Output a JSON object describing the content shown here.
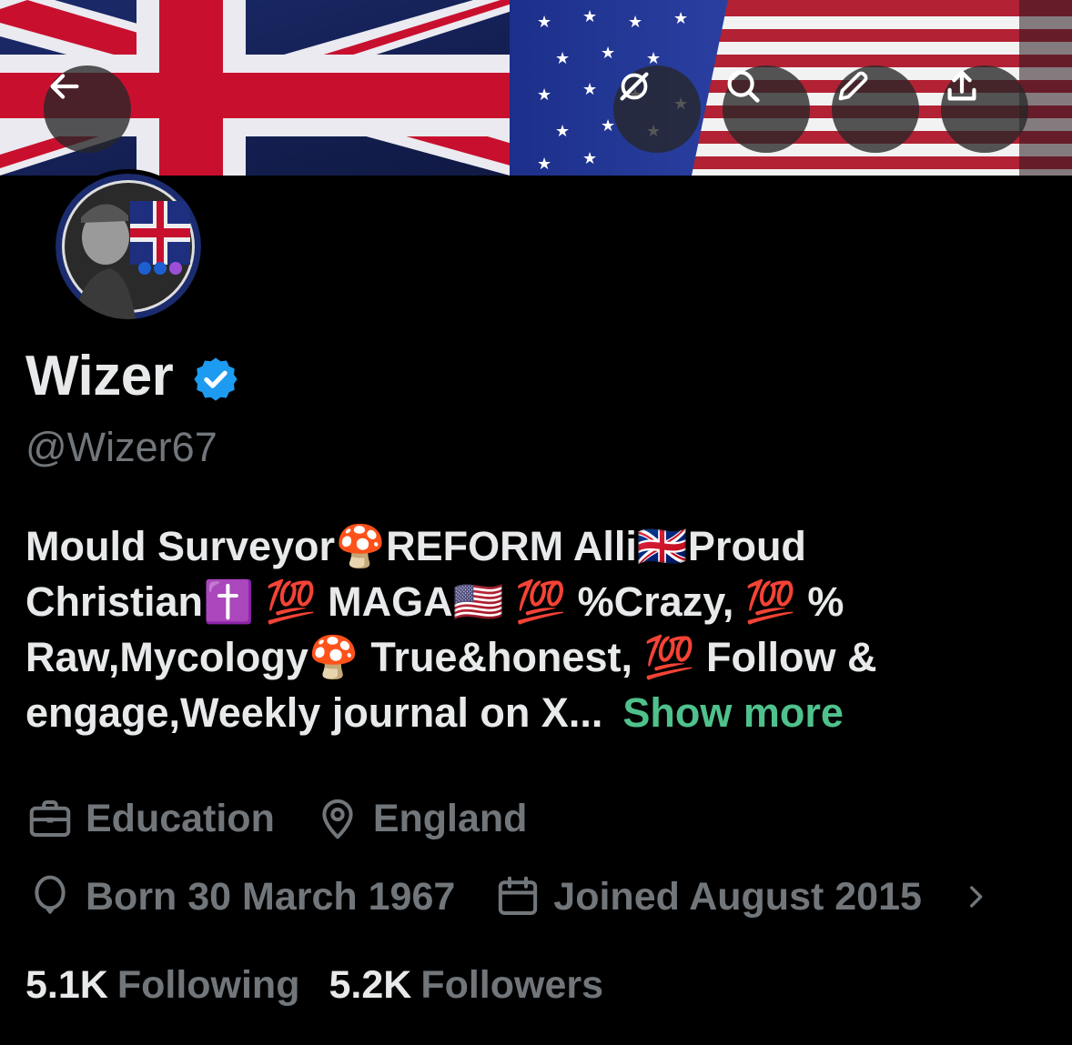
{
  "header": {
    "back_icon": "arrow-left-icon",
    "grok_icon": "grok-slash-icon",
    "search_icon": "search-icon",
    "edit_icon": "pencil-icon",
    "share_icon": "share-upload-icon"
  },
  "profile": {
    "display_name": "Wizer",
    "verified_icon": "verified-badge-icon",
    "handle": "@Wizer67",
    "bio_lines": [
      "Mould Surveyor🍄REFORM Alli🇬🇧Proud",
      "Christian✝️ 💯 MAGA🇺🇸 💯 %Crazy, 💯 %",
      "Raw,Mycology🍄 True&honest, 💯 Follow &",
      "engage,Weekly journal on X..."
    ],
    "show_more": "Show more",
    "category": "Education",
    "location": "England",
    "birthday": "Born 30 March 1967",
    "joined": "Joined August 2015",
    "following_count": "5.1K",
    "following_label": "Following",
    "followers_count": "5.2K",
    "followers_label": "Followers"
  },
  "colors": {
    "background": "#000000",
    "primary_text": "#e7e9ea",
    "secondary_text": "#71767b",
    "verified_blue": "#1d9bf0",
    "show_more_link": "#4fc18c"
  }
}
